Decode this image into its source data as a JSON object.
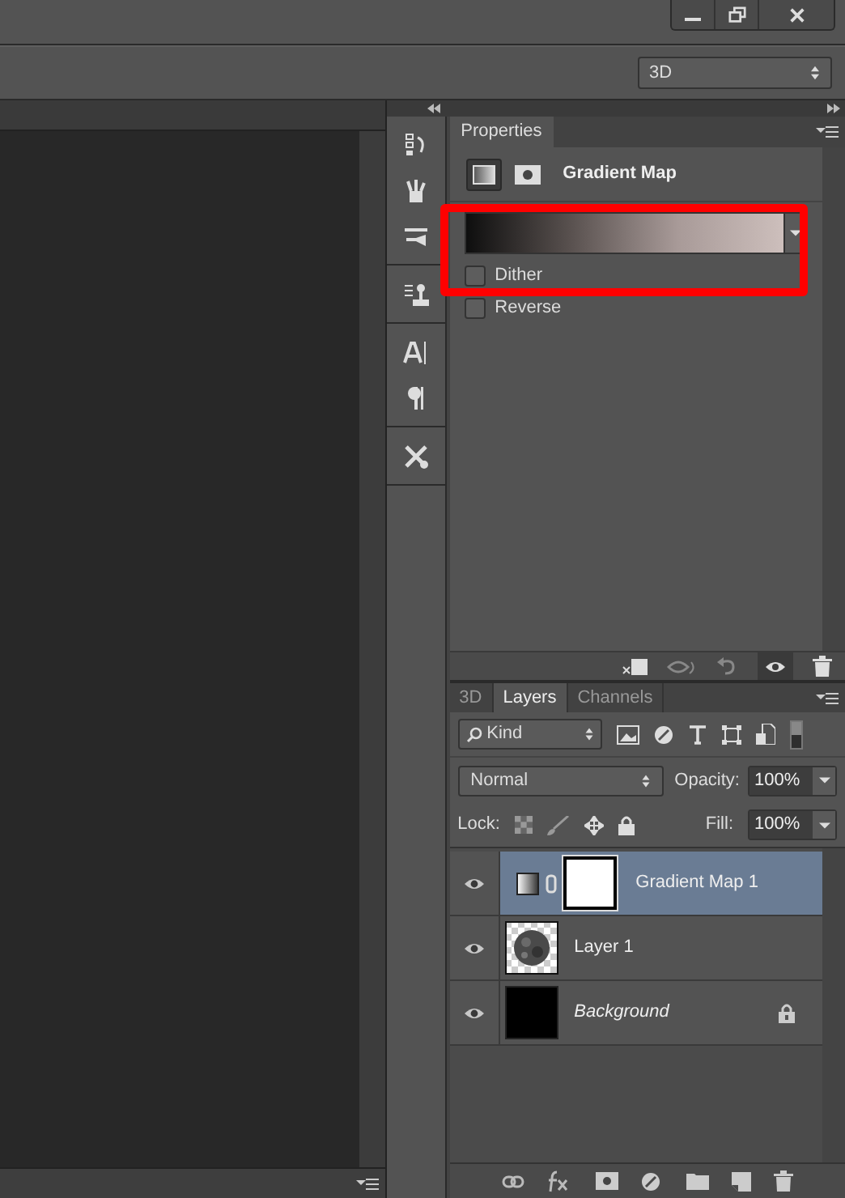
{
  "workspace": {
    "value": "3D"
  },
  "properties": {
    "tab": "Properties",
    "title": "Gradient Map",
    "modes": [
      {
        "kind": "adjustment",
        "selected": true
      },
      {
        "kind": "mask",
        "selected": false
      }
    ],
    "options": [
      {
        "label": "Dither",
        "checked": false
      },
      {
        "label": "Reverse",
        "checked": false
      }
    ],
    "highlight": true
  },
  "layers_panel": {
    "tabs": [
      {
        "label": "3D",
        "selected": false
      },
      {
        "label": "Layers",
        "selected": true
      },
      {
        "label": "Channels",
        "selected": false
      }
    ],
    "filter": "Kind",
    "blend_mode": "Normal",
    "opacity_label": "Opacity:",
    "opacity": "100%",
    "lock_label": "Lock:",
    "fill_label": "Fill:",
    "fill": "100%",
    "layers": [
      {
        "name": "Gradient Map 1",
        "kind": "adjustment",
        "visible": true,
        "selected": true,
        "locked": false,
        "italic": false
      },
      {
        "name": "Layer 1",
        "kind": "image",
        "visible": true,
        "selected": false,
        "locked": false,
        "italic": false
      },
      {
        "name": "Background",
        "kind": "fill",
        "visible": true,
        "selected": false,
        "locked": true,
        "italic": true
      }
    ]
  }
}
